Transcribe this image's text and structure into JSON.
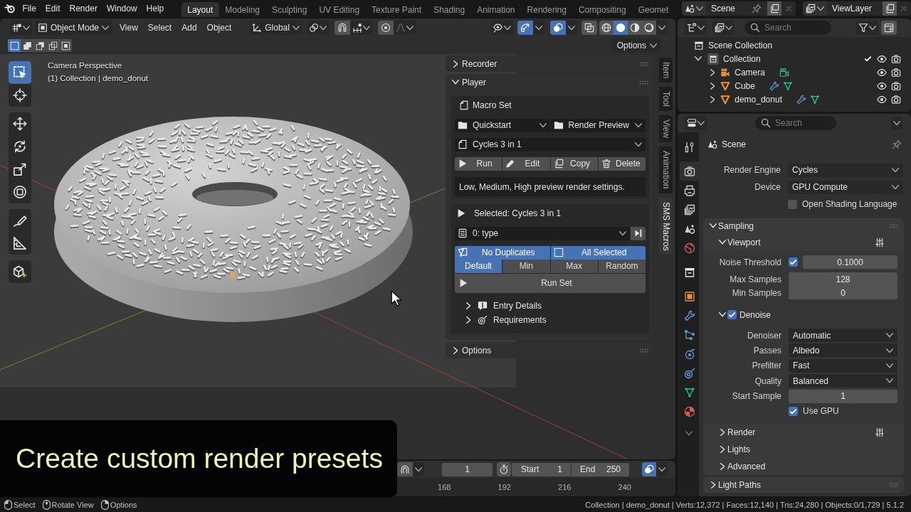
{
  "top_bar": {
    "menus": [
      "File",
      "Edit",
      "Render",
      "Window",
      "Help"
    ],
    "workspaces": [
      {
        "label": "Layout",
        "selected": true
      },
      {
        "label": "Modeling",
        "selected": false
      },
      {
        "label": "Sculpting",
        "selected": false
      },
      {
        "label": "UV Editing",
        "selected": false
      },
      {
        "label": "Texture Paint",
        "selected": false
      },
      {
        "label": "Shading",
        "selected": false
      },
      {
        "label": "Animation",
        "selected": false
      },
      {
        "label": "Rendering",
        "selected": false
      },
      {
        "label": "Compositing",
        "selected": false
      },
      {
        "label": "Geomet",
        "selected": false
      }
    ],
    "scene": "Scene",
    "view_layer": "ViewLayer"
  },
  "viewport": {
    "mode": "Object Mode",
    "menus": [
      "View",
      "Select",
      "Add",
      "Object"
    ],
    "orientation": "Global",
    "show_gizmos": true,
    "show_overlays": true,
    "xray": false,
    "shading": [
      {
        "selected": false
      },
      {
        "selected": true
      },
      {
        "selected": false
      },
      {
        "selected": false
      }
    ],
    "select_modes": [
      {
        "selected": true
      },
      {
        "selected": false
      },
      {
        "selected": false
      },
      {
        "selected": false
      },
      {
        "selected": false
      }
    ],
    "options": "Options",
    "tools": [
      {
        "selected": true
      },
      {
        "selected": false
      },
      {
        "selected": false
      },
      {
        "selected": false
      },
      {
        "selected": false
      },
      {
        "selected": false
      },
      {
        "selected": false
      },
      {
        "selected": false
      },
      {
        "selected": false
      }
    ],
    "info": [
      "Camera Perspective",
      "(1) Collection | demo_donut"
    ]
  },
  "sidebar": {
    "panels": [
      {
        "title": "Recorder",
        "expanded": false
      },
      {
        "title": "Player",
        "expanded": true,
        "content": {
          "macro_set": "Macro Set",
          "category": "Quickstart",
          "group": "Render Preview",
          "macro": "Cycles 3 in 1",
          "actions": [
            "Run",
            "Edit",
            "Copy",
            "Delete"
          ],
          "description": "Low, Medium, High preview render settings.",
          "selected_label": "Selected: Cycles 3 in 1",
          "entry": "0: type",
          "toggles": [
            {
              "label": "No Duplicates",
              "on": true
            },
            {
              "label": "All Selected",
              "on": true
            }
          ],
          "modes": [
            {
              "label": "Default",
              "selected": true
            },
            {
              "label": "Min",
              "selected": false
            },
            {
              "label": "Max",
              "selected": false
            },
            {
              "label": "Random",
              "selected": false
            }
          ],
          "run_set": "Run Set",
          "sections": [
            {
              "title": "Entry Details",
              "expanded": false
            },
            {
              "title": "Requirements",
              "expanded": false
            }
          ]
        }
      },
      {
        "title": "Options",
        "expanded": false
      }
    ],
    "tabs": [
      {
        "label": "Item",
        "selected": false
      },
      {
        "label": "Tool",
        "selected": false
      },
      {
        "label": "View",
        "selected": false
      },
      {
        "label": "Animation",
        "selected": false
      },
      {
        "label": "SMS Macros",
        "selected": true
      }
    ]
  },
  "outliner": {
    "search": {
      "placeholder": "Search"
    },
    "items": [
      {
        "name": "Scene Collection",
        "kind": "scene_collection",
        "children": [
          {
            "name": "Collection",
            "kind": "collection",
            "expanded": true,
            "checked": true,
            "children": [
              {
                "name": "Camera",
                "kind": "camera",
                "expanded": false
              },
              {
                "name": "Cube",
                "kind": "mesh",
                "expanded": false,
                "modifier": true
              },
              {
                "name": "demo_donut",
                "kind": "mesh",
                "expanded": false,
                "modifier": true
              }
            ]
          }
        ]
      }
    ]
  },
  "properties": {
    "search": {
      "placeholder": "Search"
    },
    "tabs": [
      {
        "selected": false
      },
      {
        "selected": true
      },
      {
        "selected": false
      },
      {
        "selected": false
      },
      {
        "selected": false
      },
      {
        "selected": false
      },
      {
        "selected": false
      },
      {
        "selected": false
      },
      {
        "selected": false
      },
      {
        "selected": false
      },
      {
        "selected": false
      },
      {
        "selected": false
      },
      {
        "selected": false
      },
      {
        "selected": false
      }
    ],
    "context": "Scene",
    "fields": [
      {
        "kind": "dropdown",
        "label": "Render Engine",
        "value": "Cycles"
      },
      {
        "kind": "dropdown",
        "label": "Device",
        "value": "GPU Compute"
      },
      {
        "kind": "checkbox",
        "label": "Open Shading Language",
        "checked": false
      }
    ],
    "panels": [
      {
        "title": "Sampling",
        "expanded": true,
        "subpanels": [
          {
            "title": "Viewport",
            "expanded": true,
            "presets": true,
            "rows": [
              {
                "kind": "toggle_number",
                "label": "Noise Threshold",
                "checked": true,
                "value": "0.1000"
              },
              {
                "kind": "number",
                "label": "Max Samples",
                "value": "128"
              },
              {
                "kind": "number",
                "label": "Min Samples",
                "value": "0"
              }
            ],
            "subpanels": [
              {
                "title": "Denoise",
                "expanded": true,
                "checked": true,
                "rows": [
                  {
                    "kind": "dropdown",
                    "label": "Denoiser",
                    "value": "Automatic"
                  },
                  {
                    "kind": "dropdown",
                    "label": "Passes",
                    "value": "Albedo"
                  },
                  {
                    "kind": "dropdown",
                    "label": "Prefilter",
                    "value": "Fast"
                  },
                  {
                    "kind": "dropdown",
                    "label": "Quality",
                    "value": "Balanced"
                  },
                  {
                    "kind": "number",
                    "label": "Start Sample",
                    "value": "1"
                  },
                  {
                    "kind": "checkbox",
                    "label": "Use GPU",
                    "checked": true
                  }
                ]
              }
            ]
          },
          {
            "title": "Render",
            "expanded": false,
            "presets": true
          },
          {
            "title": "Lights",
            "expanded": false
          },
          {
            "title": "Advanced",
            "expanded": false
          }
        ]
      },
      {
        "title": "Light Paths",
        "expanded": false
      }
    ]
  },
  "timeline": {
    "current_frame": "1",
    "start_label": "Start",
    "start": "1",
    "end_label": "End",
    "end": "250",
    "show_overlays": true,
    "ticks": [
      "168",
      "192",
      "216",
      "240"
    ]
  },
  "status_bar": {
    "hints": [
      "Select",
      "Rotate View",
      "Options"
    ],
    "info": "Collection | demo_donut | Verts:12,372 | Faces:12,140 | Tris:24,280 | Objects:0/1,729 | 5.1.2"
  },
  "caption": "Create custom render presets"
}
